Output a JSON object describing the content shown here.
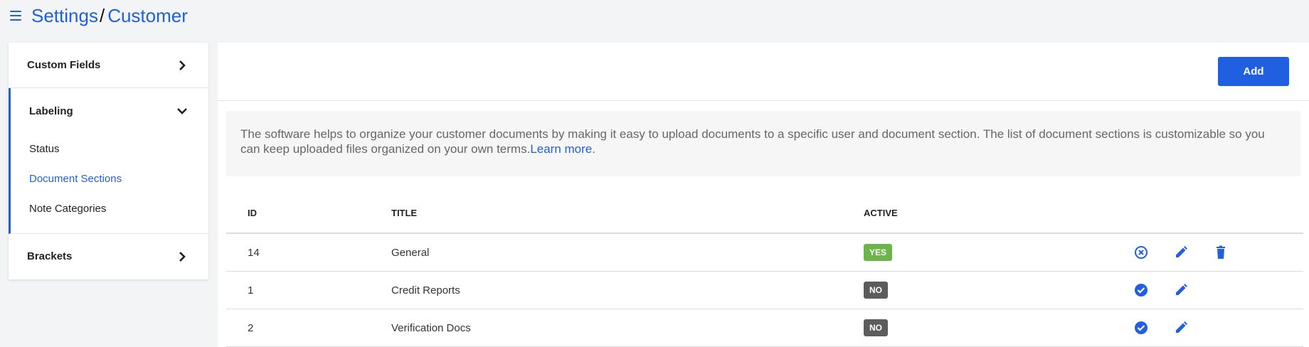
{
  "header": {
    "menu_icon": "hamburger-icon",
    "crumbs": [
      "Settings",
      "Customer"
    ],
    "separator": "/"
  },
  "sidebar": {
    "custom_fields": "Custom Fields",
    "labeling": "Labeling",
    "labeling_items": [
      "Status",
      "Document Sections",
      "Note Categories"
    ],
    "active_item": "Document Sections",
    "brackets": "Brackets"
  },
  "toolbar": {
    "add_label": "Add"
  },
  "info": {
    "text": "The software helps to organize your customer documents by making it easy to upload documents to a specific user and document section. The list of document sections is customizable so you can keep uploaded files organized on your own terms.",
    "link": "Learn more",
    "suffix": "."
  },
  "table": {
    "headers": {
      "id": "ID",
      "title": "TITLE",
      "active": "ACTIVE"
    },
    "rows": [
      {
        "id": "14",
        "title": "General",
        "active": "YES"
      },
      {
        "id": "1",
        "title": "Credit Reports",
        "active": "NO"
      },
      {
        "id": "2",
        "title": "Verification Docs",
        "active": "NO"
      }
    ]
  },
  "colors": {
    "accent": "#1f5fe0",
    "yes": "#6bb54a",
    "no": "#5c5c5c"
  }
}
